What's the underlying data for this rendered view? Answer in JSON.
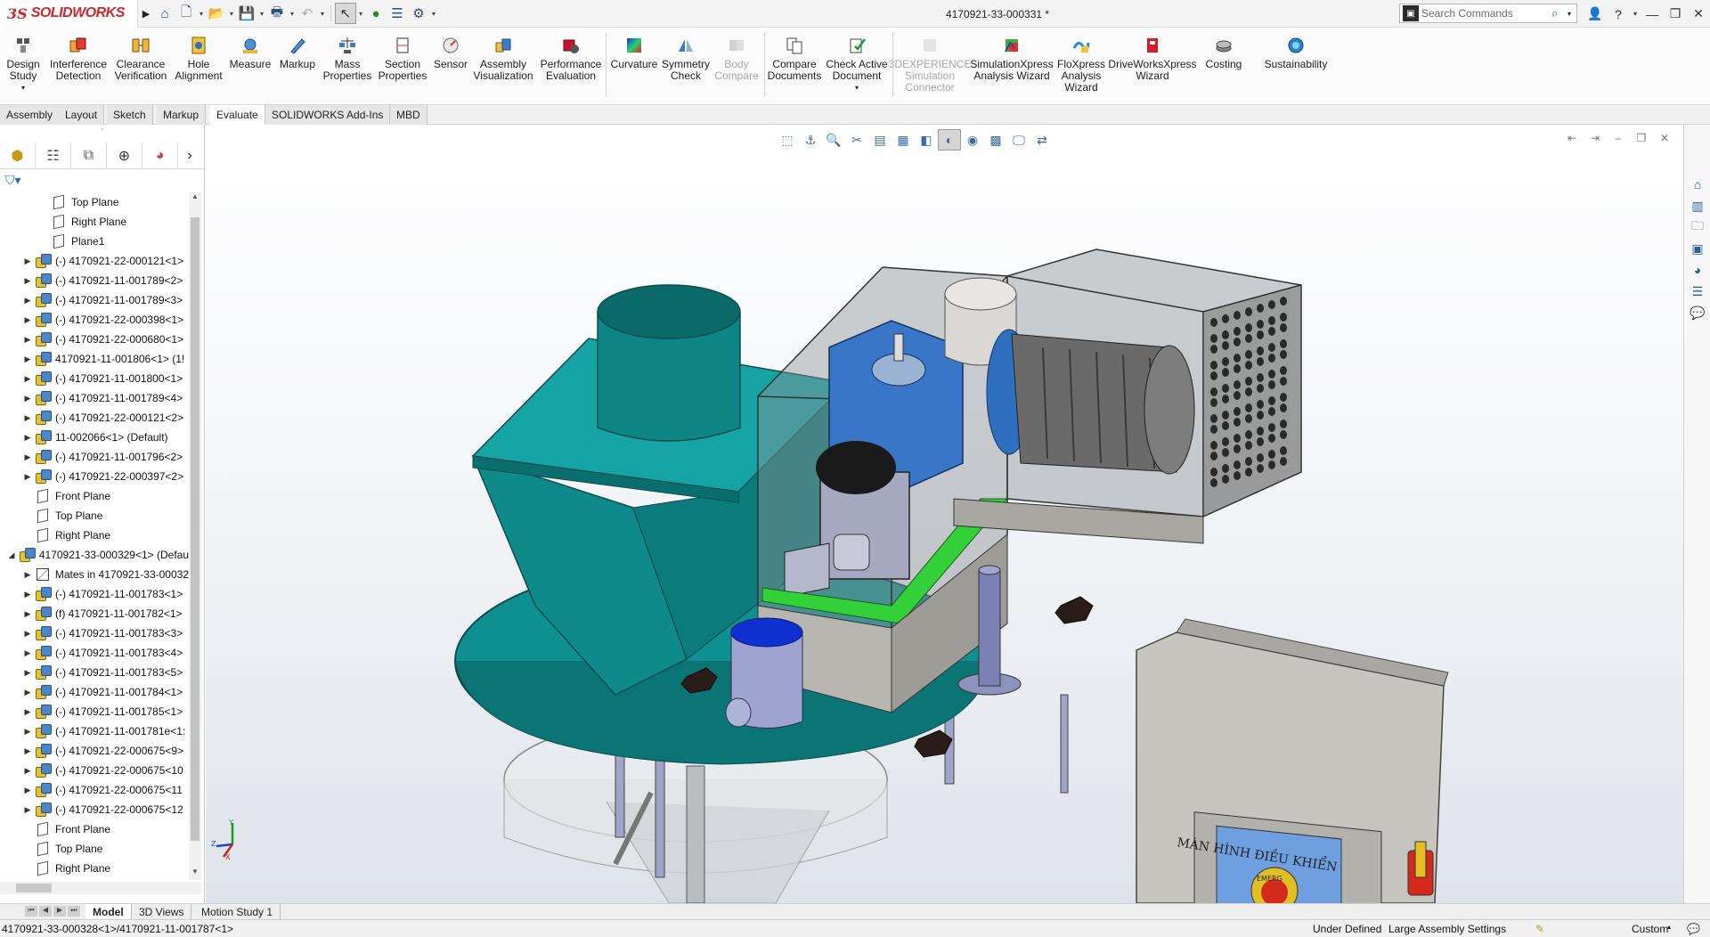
{
  "app": {
    "brand_ds": "3S",
    "brand_name": "SOLIDWORKS",
    "document_title": "4170921-33-000331 *"
  },
  "search": {
    "placeholder": "Search Commands"
  },
  "ribbon": {
    "buttons": [
      {
        "label": "Design\nStudy",
        "icon": "design-study-icon"
      },
      {
        "label": "Interference\nDetection",
        "icon": "interference-icon"
      },
      {
        "label": "Clearance\nVerification",
        "icon": "clearance-icon"
      },
      {
        "label": "Hole\nAlignment",
        "icon": "hole-alignment-icon"
      },
      {
        "label": "Measure",
        "icon": "measure-icon"
      },
      {
        "label": "Markup",
        "icon": "markup-icon"
      },
      {
        "label": "Mass\nProperties",
        "icon": "mass-properties-icon"
      },
      {
        "label": "Section\nProperties",
        "icon": "section-properties-icon"
      },
      {
        "label": "Sensor",
        "icon": "sensor-icon"
      },
      {
        "label": "Assembly\nVisualization",
        "icon": "assembly-visualization-icon"
      },
      {
        "label": "Performance\nEvaluation",
        "icon": "performance-icon"
      },
      {
        "label": "Curvature",
        "icon": "curvature-icon"
      },
      {
        "label": "Symmetry\nCheck",
        "icon": "symmetry-icon"
      },
      {
        "label": "Body\nCompare",
        "icon": "body-compare-icon"
      },
      {
        "label": "Compare\nDocuments",
        "icon": "compare-documents-icon"
      },
      {
        "label": "Check Active\nDocument",
        "icon": "check-document-icon"
      },
      {
        "label": "3DEXPERIENCE\nSimulation\nConnector",
        "icon": "3dexperience-icon"
      },
      {
        "label": "SimulationXpress\nAnalysis Wizard",
        "icon": "simulationxpress-icon"
      },
      {
        "label": "FloXpress\nAnalysis\nWizard",
        "icon": "floxpress-icon"
      },
      {
        "label": "DriveWorksXpress\nWizard",
        "icon": "driveworks-icon"
      },
      {
        "label": "Costing",
        "icon": "costing-icon"
      },
      {
        "label": "Sustainability",
        "icon": "sustainability-icon"
      }
    ]
  },
  "command_tabs": [
    "Assembly",
    "Layout",
    "Sketch",
    "Markup",
    "Evaluate",
    "SOLIDWORKS Add-Ins",
    "MBD"
  ],
  "active_command_tab": "Evaluate",
  "tree": {
    "rows": [
      {
        "label": "Top Plane",
        "type": "plane",
        "indent": 3,
        "expand": false
      },
      {
        "label": "Right Plane",
        "type": "plane",
        "indent": 3,
        "expand": false
      },
      {
        "label": "Plane1",
        "type": "plane",
        "indent": 3,
        "expand": false
      },
      {
        "label": "(-) 4170921-22-000121<1>",
        "type": "part",
        "indent": 2,
        "expand": true
      },
      {
        "label": "(-) 4170921-11-001789<2>",
        "type": "part",
        "indent": 2,
        "expand": true
      },
      {
        "label": "(-) 4170921-11-001789<3>",
        "type": "part",
        "indent": 2,
        "expand": true
      },
      {
        "label": "(-) 4170921-22-000398<1>",
        "type": "part",
        "indent": 2,
        "expand": true
      },
      {
        "label": "(-) 4170921-22-000680<1>",
        "type": "part",
        "indent": 2,
        "expand": true
      },
      {
        "label": "4170921-11-001806<1> (1!",
        "type": "part",
        "indent": 2,
        "expand": true
      },
      {
        "label": "(-) 4170921-11-001800<1>",
        "type": "part",
        "indent": 2,
        "expand": true
      },
      {
        "label": "(-) 4170921-11-001789<4>",
        "type": "part",
        "indent": 2,
        "expand": true
      },
      {
        "label": "(-) 4170921-22-000121<2>",
        "type": "part",
        "indent": 2,
        "expand": true
      },
      {
        "label": "11-002066<1> (Default)",
        "type": "part",
        "indent": 2,
        "expand": true
      },
      {
        "label": "(-) 4170921-11-001796<2>",
        "type": "part",
        "indent": 2,
        "expand": true
      },
      {
        "label": "(-) 4170921-22-000397<2>",
        "type": "part",
        "indent": 2,
        "expand": true
      },
      {
        "label": "Front Plane",
        "type": "plane",
        "indent": 2,
        "expand": false
      },
      {
        "label": "Top Plane",
        "type": "plane",
        "indent": 2,
        "expand": false
      },
      {
        "label": "Right Plane",
        "type": "plane",
        "indent": 2,
        "expand": false
      },
      {
        "label": "4170921-33-000329<1> (Defau",
        "type": "part",
        "indent": 1,
        "expand": "open"
      },
      {
        "label": "Mates in 4170921-33-00032",
        "type": "mates",
        "indent": 2,
        "expand": true
      },
      {
        "label": "(-) 4170921-11-001783<1>",
        "type": "part",
        "indent": 2,
        "expand": true
      },
      {
        "label": "(f) 4170921-11-001782<1>",
        "type": "part",
        "indent": 2,
        "expand": true
      },
      {
        "label": "(-) 4170921-11-001783<3>",
        "type": "part",
        "indent": 2,
        "expand": true
      },
      {
        "label": "(-) 4170921-11-001783<4>",
        "type": "part",
        "indent": 2,
        "expand": true
      },
      {
        "label": "(-) 4170921-11-001783<5>",
        "type": "part",
        "indent": 2,
        "expand": true
      },
      {
        "label": "(-) 4170921-11-001784<1>",
        "type": "part",
        "indent": 2,
        "expand": true
      },
      {
        "label": "(-) 4170921-11-001785<1>",
        "type": "part",
        "indent": 2,
        "expand": true
      },
      {
        "label": "(-) 4170921-11-001781e<1:",
        "type": "part",
        "indent": 2,
        "expand": true
      },
      {
        "label": "(-) 4170921-22-000675<9>",
        "type": "part",
        "indent": 2,
        "expand": true
      },
      {
        "label": "(-) 4170921-22-000675<10",
        "type": "part",
        "indent": 2,
        "expand": true
      },
      {
        "label": "(-) 4170921-22-000675<11",
        "type": "part",
        "indent": 2,
        "expand": true
      },
      {
        "label": "(-) 4170921-22-000675<12",
        "type": "part",
        "indent": 2,
        "expand": true
      },
      {
        "label": "Front Plane",
        "type": "plane",
        "indent": 2,
        "expand": false
      },
      {
        "label": "Top Plane",
        "type": "plane",
        "indent": 2,
        "expand": false
      },
      {
        "label": "Right Plane",
        "type": "plane",
        "indent": 2,
        "expand": false
      }
    ]
  },
  "model": {
    "panel_caption": "MÀN HÌNH ĐIỀU KHIỂN",
    "estop_caption": "EMERG"
  },
  "bottom_tabs": [
    "Model",
    "3D Views",
    "Motion Study 1"
  ],
  "active_bottom_tab": "Model",
  "status": {
    "path": "4170921-33-000328<1>/4170921-11-001787<1>",
    "definition": "Under Defined",
    "settings": "Large Assembly Settings",
    "units": "Custom"
  },
  "colors": {
    "teal_body": "#0f8f8f",
    "glass": "#9aa0a4",
    "motor_blue": "#2f6fc0",
    "hmi_screen": "#6f9fe0",
    "brand_red": "#d1262d"
  }
}
